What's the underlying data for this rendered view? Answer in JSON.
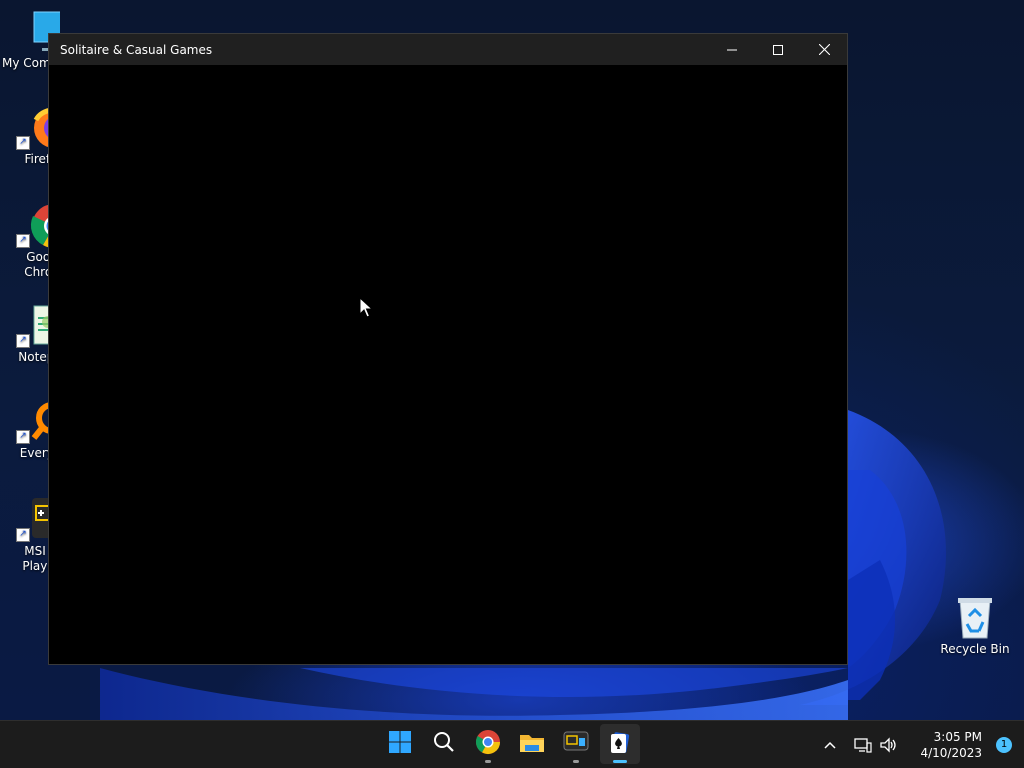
{
  "desktop": {
    "icons": [
      {
        "label": "My Com",
        "icon": "computer-icon"
      },
      {
        "label": "Firefo",
        "icon": "firefox-icon"
      },
      {
        "label": "Goog\nChron",
        "icon": "chrome-icon"
      },
      {
        "label": "Notepa",
        "icon": "notepad-icon"
      },
      {
        "label": "Everyth",
        "icon": "everything-search-icon"
      },
      {
        "label": "MSI A\nPlayer",
        "icon": "msi-app-player-icon"
      },
      {
        "label": "Recycle Bin",
        "icon": "recycle-bin-icon"
      }
    ]
  },
  "window": {
    "title": "Solitaire & Casual Games",
    "controls": [
      "minimize",
      "maximize",
      "close"
    ]
  },
  "taskbar": {
    "apps": [
      {
        "name": "Start",
        "icon": "windows-start-icon"
      },
      {
        "name": "Search",
        "icon": "search-icon"
      },
      {
        "name": "Google Chrome",
        "icon": "chrome-icon",
        "running": true
      },
      {
        "name": "File Explorer",
        "icon": "folder-icon"
      },
      {
        "name": "MSI App Player",
        "icon": "msi-app-player-icon",
        "running": true
      },
      {
        "name": "Solitaire & Casual Games",
        "icon": "solitaire-icon",
        "active": true
      }
    ],
    "tray": {
      "time": "3:05 PM",
      "date": "4/10/2023",
      "notification_count": "1"
    }
  },
  "colors": {
    "taskbar_bg": "#1c1c1c",
    "titlebar_bg": "#202020",
    "accent": "#4cc2ff",
    "window_content_bg": "#000000"
  }
}
